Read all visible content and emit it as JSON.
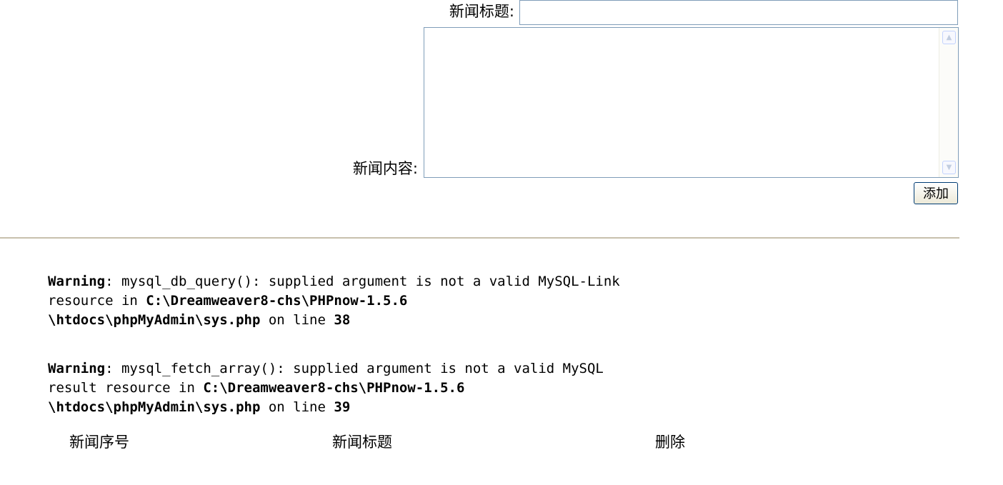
{
  "form": {
    "title_label": "新闻标题:",
    "title_value": "",
    "content_label": "新闻内容:",
    "content_value": "",
    "add_button_label": "添加",
    "scroll_up_icon": "arrow-up-icon",
    "scroll_down_icon": "arrow-down-icon"
  },
  "warnings": [
    {
      "label": "Warning",
      "sep": ": ",
      "message_1": "mysql_db_query(): supplied argument is not a valid MySQL-Link",
      "message_2": "resource in ",
      "path_1": "C:\\Dreamweaver8-chs\\PHPnow-1.5.6",
      "path_2": "\\htdocs\\phpMyAdmin\\sys.php",
      "line_text": " on line ",
      "line_number": "38"
    },
    {
      "label": "Warning",
      "sep": ": ",
      "message_1": "mysql_fetch_array(): supplied argument is not a valid MySQL",
      "message_2": "result resource in ",
      "path_1": "C:\\Dreamweaver8-chs\\PHPnow-1.5.6",
      "path_2": "\\htdocs\\phpMyAdmin\\sys.php",
      "line_text": " on line ",
      "line_number": "39"
    }
  ],
  "table": {
    "headers": [
      "新闻序号",
      "新闻标题",
      "删除"
    ]
  },
  "colors": {
    "input_border": "#7f9db9",
    "divider": "#c8c0ad",
    "button_border": "#003c74"
  }
}
